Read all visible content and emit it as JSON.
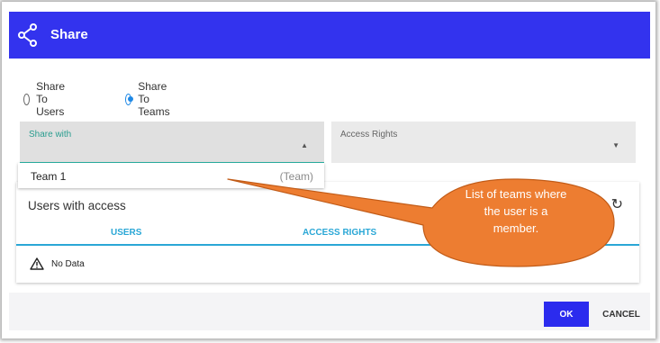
{
  "dialog": {
    "title": "Share",
    "icon": "share-icon",
    "header_color": "#3333ee"
  },
  "share_mode": {
    "options": [
      {
        "label": "Share To Users",
        "checked": false
      },
      {
        "label": "Share To Teams",
        "checked": true
      }
    ]
  },
  "share_with": {
    "label": "Share with",
    "options": [
      {
        "name": "Team 1",
        "type": "(Team)"
      }
    ]
  },
  "access_rights": {
    "label": "Access Rights"
  },
  "users_with_access": {
    "title": "Users with access",
    "columns": [
      "USERS",
      "ACCESS RIGHTS"
    ],
    "empty_text": "No Data",
    "accent_color": "#2aa7d6"
  },
  "footer": {
    "ok_label": "OK",
    "cancel_label": "CANCEL"
  },
  "callout": {
    "text_lines": [
      "List of teams where",
      "the user is a",
      "member."
    ],
    "color": "#ed7d31"
  }
}
